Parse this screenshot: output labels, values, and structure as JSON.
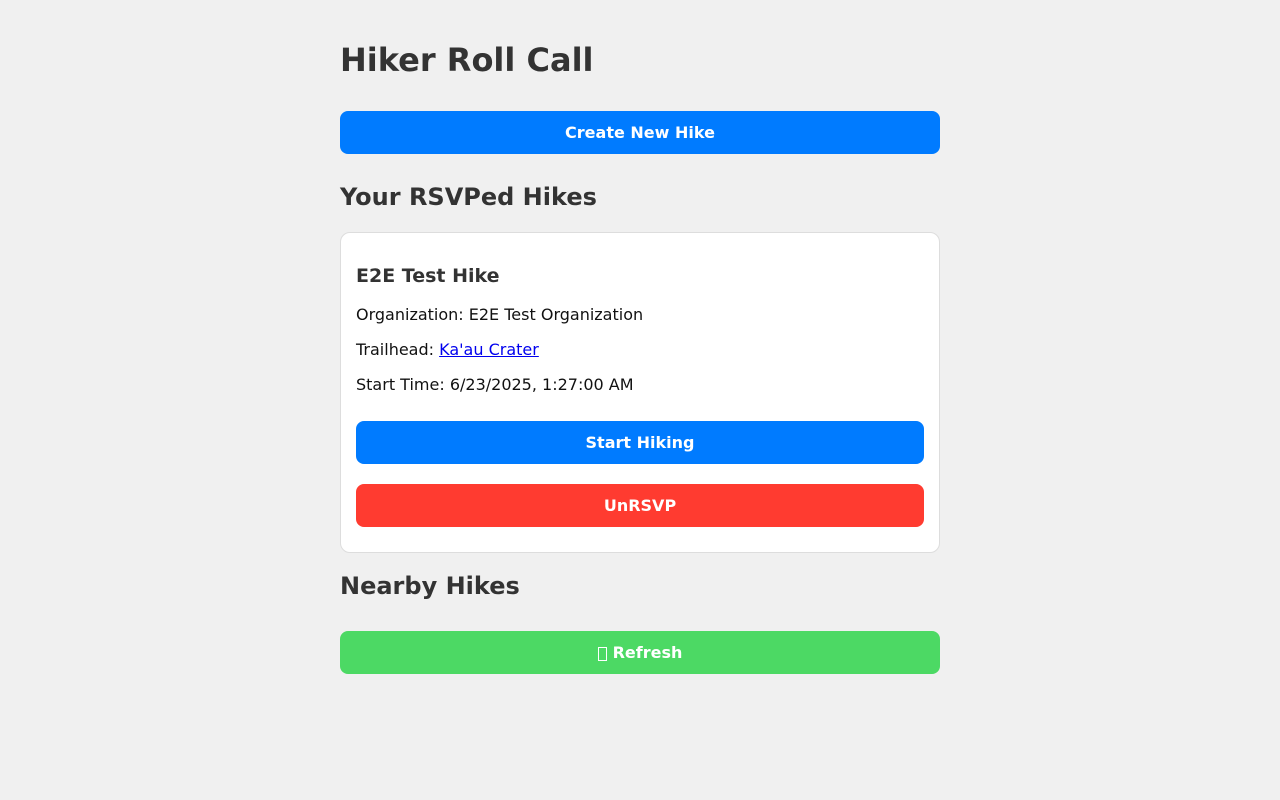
{
  "page": {
    "title": "Hiker Roll Call"
  },
  "actions": {
    "create_hike_label": "Create New Hike"
  },
  "rsvped": {
    "heading": "Your RSVPed Hikes",
    "hikes": [
      {
        "name": "E2E Test Hike",
        "organization_label": "Organization: ",
        "organization": "E2E Test Organization",
        "trailhead_label": "Trailhead: ",
        "trailhead": "Ka'au Crater",
        "start_time_label": "Start Time: ",
        "start_time": "6/23/2025, 1:27:00 AM",
        "start_button_label": "Start Hiking",
        "unrsvp_button_label": "UnRSVP"
      }
    ]
  },
  "nearby": {
    "heading": "Nearby Hikes",
    "refresh_label": "Refresh",
    "refresh_icon": "refresh-icon"
  },
  "colors": {
    "background": "#f0f0f0",
    "primary": "#007bff",
    "danger": "#ff3b30",
    "success": "#4cd964",
    "link": "#0000ee"
  }
}
